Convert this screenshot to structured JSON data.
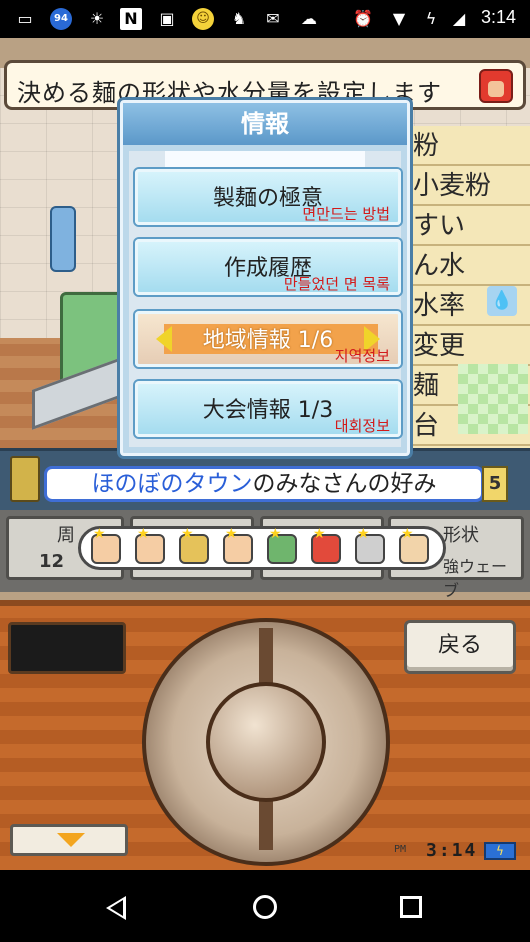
{
  "status_bar": {
    "time": "3:14",
    "badge_number": "94",
    "n_label": "N"
  },
  "scene": {
    "instruction": "決める麺の形状や水分量を設定します",
    "right_panel": [
      "粉",
      "小麦粉",
      "すい",
      "ん水",
      "水率",
      "変更",
      "麺",
      "台"
    ]
  },
  "dialog": {
    "title": "情報",
    "items": [
      {
        "label": "製麺の極意",
        "sub": "면만드는 방법"
      },
      {
        "label": "作成履歴",
        "sub": "만들었던 면 목록"
      },
      {
        "label": "地域情報 1/6",
        "sub": "지역정보"
      },
      {
        "label": "大会情報 1/3",
        "sub": "대회정보"
      }
    ]
  },
  "town_bar": {
    "prefix": "ほのぼのタウン",
    "suffix": "のみなさんの好み",
    "badge": "5"
  },
  "stats": {
    "card1_label": "周",
    "card1_value": "12",
    "card2_label": "形状",
    "card2_value": "強ウェーブ"
  },
  "controls": {
    "back_label": "戻る",
    "clock_prefix": "PM",
    "clock": "3:14"
  },
  "colors": {
    "dialog_title": "#5b98c9",
    "selected_item": "#f2a24b",
    "subtext_red": "#d21b1b",
    "town_name_blue": "#2a5fd8"
  }
}
